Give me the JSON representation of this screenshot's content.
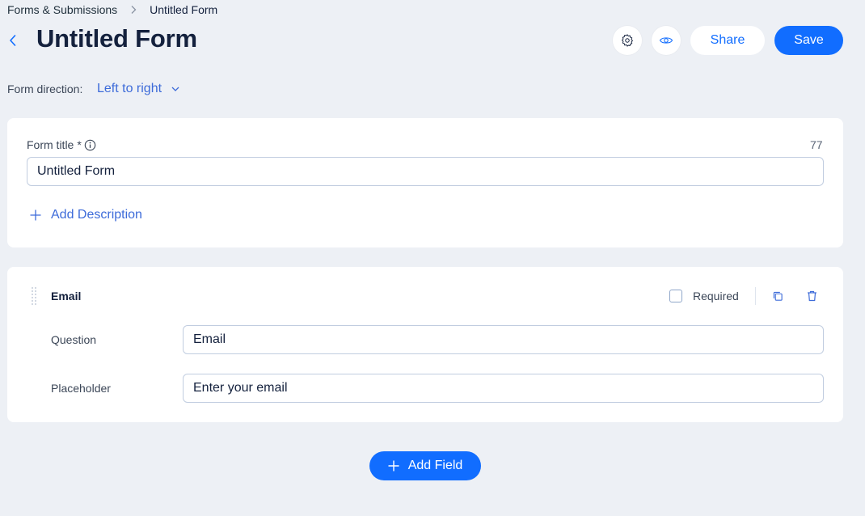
{
  "breadcrumb": {
    "parent": "Forms & Submissions",
    "current": "Untitled Form"
  },
  "header": {
    "title": "Untitled Form",
    "share_label": "Share",
    "save_label": "Save"
  },
  "form_direction": {
    "label": "Form direction:",
    "value": "Left to right"
  },
  "title_card": {
    "label": "Form title",
    "required_mark": "*",
    "char_count": "77",
    "input_value": "Untitled Form",
    "add_description_label": "Add Description"
  },
  "email_field": {
    "heading": "Email",
    "required_label": "Required",
    "required_checked": false,
    "question_label": "Question",
    "question_value": "Email",
    "placeholder_label": "Placeholder",
    "placeholder_value": "Enter your email"
  },
  "add_field_label": "Add Field",
  "icons": {
    "back": "chevron-left-icon",
    "settings": "gear-icon",
    "preview": "eye-icon",
    "info": "info-icon",
    "plus": "plus-icon",
    "duplicate": "duplicate-icon",
    "delete": "trash-icon",
    "drag": "drag-handle-icon"
  },
  "colors": {
    "accent": "#116dff",
    "link": "#3d6bd9",
    "background": "#edf0f5",
    "text": "#14213d"
  }
}
